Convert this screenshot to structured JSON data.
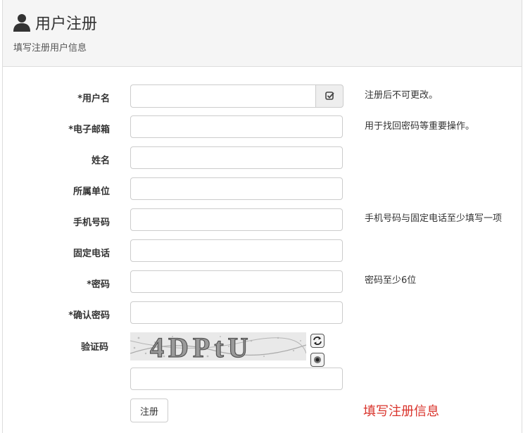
{
  "header": {
    "title": "用户注册",
    "subtitle": "填写注册用户信息"
  },
  "form": {
    "fields": [
      {
        "label": "*用户名",
        "value": "",
        "hint": "注册后不可更改。"
      },
      {
        "label": "*电子邮箱",
        "value": "",
        "hint": "用于找回密码等重要操作。"
      },
      {
        "label": "姓名",
        "value": "",
        "hint": ""
      },
      {
        "label": "所属单位",
        "value": "",
        "hint": ""
      },
      {
        "label": "手机号码",
        "value": "",
        "hint": "手机号码与固定电话至少填写一项"
      },
      {
        "label": "固定电话",
        "value": "",
        "hint": ""
      },
      {
        "label": "*密码",
        "value": "",
        "hint": "密码至少6位"
      },
      {
        "label": "*确认密码",
        "value": "",
        "hint": ""
      }
    ],
    "captcha": {
      "label": "验证码",
      "image_text": "4DPtU",
      "value": ""
    },
    "submit_label": "注册",
    "status_message": "填写注册信息"
  },
  "colors": {
    "accent_error": "#d9332b",
    "header_bg": "#f5f5f5",
    "border": "#cccccc"
  },
  "icons": [
    "user-icon",
    "check-square-icon",
    "refresh-icon",
    "audio-icon"
  ]
}
